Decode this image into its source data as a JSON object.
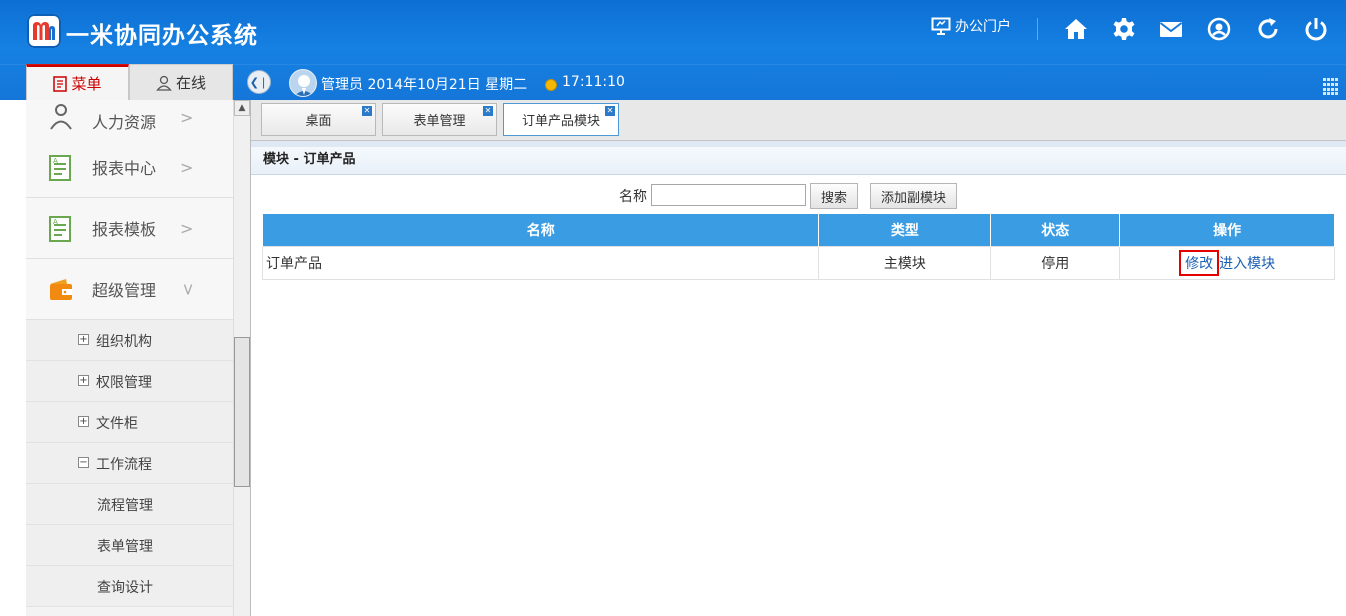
{
  "app": {
    "title": "一米协同办公系统"
  },
  "header": {
    "portal_label": "办公门户",
    "icons": [
      "home-icon",
      "gear-icon",
      "mail-icon",
      "user-circle-icon",
      "refresh-icon",
      "power-icon"
    ]
  },
  "left_tabs": {
    "menu": "菜单",
    "online": "在线"
  },
  "user_bar": {
    "info": "管理员 2014年10月21日 星期二",
    "time": "17:11:10"
  },
  "sidebar": {
    "items": [
      {
        "label": "人力资源",
        "icon": "people-icon"
      },
      {
        "label": "报表中心",
        "icon": "report-icon"
      },
      {
        "label": "报表模板",
        "icon": "template-icon"
      },
      {
        "label": "超级管理",
        "icon": "wallet-icon"
      }
    ],
    "sub_items": [
      {
        "label": "组织机构",
        "sign": "+"
      },
      {
        "label": "权限管理",
        "sign": "+"
      },
      {
        "label": "文件柜",
        "sign": "+"
      },
      {
        "label": "工作流程",
        "sign": "−"
      }
    ],
    "leaf_items": [
      "流程管理",
      "表单管理",
      "查询设计"
    ]
  },
  "content_tabs": [
    {
      "label": "桌面"
    },
    {
      "label": "表单管理"
    },
    {
      "label": "订单产品模块"
    }
  ],
  "panel": {
    "title": "模块 - 订单产品"
  },
  "search": {
    "label": "名称",
    "value": "",
    "search_button": "搜索",
    "add_button": "添加副模块"
  },
  "table": {
    "headers": [
      "名称",
      "类型",
      "状态",
      "操作"
    ],
    "rows": [
      {
        "name": "订单产品",
        "type": "主模块",
        "status": "停用",
        "edit": "修改",
        "enter": "进入模块"
      }
    ]
  },
  "colors": {
    "header_blue": "#1681e3",
    "table_header": "#3a9de3",
    "highlight": "#e40000"
  }
}
